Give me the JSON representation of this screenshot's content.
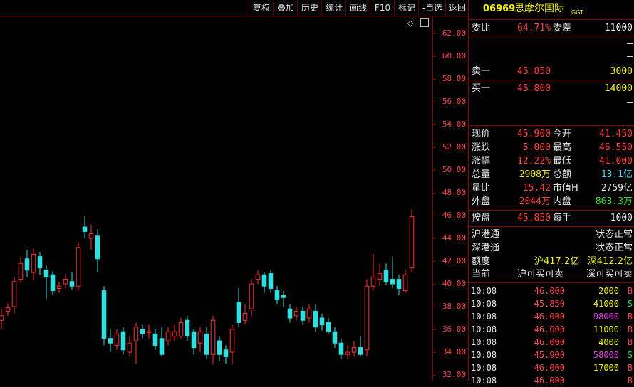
{
  "toolbar": {
    "buttons": [
      "复权",
      "叠加",
      "历史",
      "统计",
      "画线",
      "F10",
      "标记",
      "-自选",
      "返回"
    ]
  },
  "stock": {
    "code": "06969",
    "name": "思摩尔国际",
    "tag": "GGT"
  },
  "order_book": {
    "weibi_label": "委比",
    "weibi_value": "64.71%",
    "weicha_label": "委差",
    "weicha_value": "11000",
    "ask_placeholders": [
      "–",
      "–"
    ],
    "sell1_label": "卖一",
    "sell1_price": "45.850",
    "sell1_qty": "3000",
    "buy1_label": "买一",
    "buy1_price": "45.800",
    "buy1_qty": "14000",
    "bid_placeholders": [
      "–",
      "–"
    ]
  },
  "quote": {
    "rows": [
      {
        "l1": "现价",
        "v1": "45.900",
        "c1": "red",
        "l2": "今开",
        "v2": "41.450",
        "c2": "red"
      },
      {
        "l1": "涨跌",
        "v1": "5.000",
        "c1": "red",
        "l2": "最高",
        "v2": "46.550",
        "c2": "red"
      },
      {
        "l1": "涨幅",
        "v1": "12.22%",
        "c1": "red",
        "l2": "最低",
        "v2": "41.000",
        "c2": "red"
      },
      {
        "l1": "总量",
        "v1": "2908万",
        "c1": "yellow",
        "l2": "总额",
        "v2": "13.1亿",
        "c2": "cyan"
      },
      {
        "l1": "量比",
        "v1": "15.42",
        "c1": "red",
        "l2": "市值H",
        "v2": "2759亿",
        "c2": "white"
      },
      {
        "l1": "外盘",
        "v1": "2044万",
        "c1": "red",
        "l2": "内盘",
        "v2": "863.3万",
        "c2": "green"
      }
    ],
    "anpan_label": "按盘",
    "anpan_value": "45.850",
    "meishou_label": "每手",
    "meishou_value": "1000"
  },
  "connect": {
    "hu_label": "沪港通",
    "hu_status": "状态正常",
    "shen_label": "深港通",
    "shen_status": "状态正常",
    "quota_label": "额度",
    "quota_hu": "沪417.2亿",
    "quota_shen": "深412.2亿",
    "current_label": "当前",
    "current_hu": "沪可买可卖",
    "current_shen": "深可买可卖"
  },
  "trades": [
    {
      "time": "10:08",
      "price": "46.000",
      "qty": "2000",
      "qc": "yellow",
      "dir": "B"
    },
    {
      "time": "10:08",
      "price": "45.850",
      "qty": "41000",
      "qc": "yellow",
      "dir": "S"
    },
    {
      "time": "10:08",
      "price": "46.000",
      "qty": "98000",
      "qc": "magenta",
      "dir": "B"
    },
    {
      "time": "10:08",
      "price": "46.000",
      "qty": "11000",
      "qc": "yellow",
      "dir": "B"
    },
    {
      "time": "10:08",
      "price": "46.000",
      "qty": "4000",
      "qc": "yellow",
      "dir": "B"
    },
    {
      "time": "10:08",
      "price": "45.900",
      "qty": "58000",
      "qc": "magenta",
      "dir": "S"
    },
    {
      "time": "10:08",
      "price": "46.000",
      "qty": "17000",
      "qc": "yellow",
      "dir": "B"
    },
    {
      "time": "10:08",
      "price": "46.000",
      "qty": "",
      "qc": "yellow",
      "dir": "B"
    }
  ],
  "colors": {
    "up": "#ff3030",
    "down": "#30e0e0",
    "border": "#8b0000",
    "axis_text": "#ff4040"
  },
  "chart_data": {
    "type": "candlestick",
    "y_ticks": [
      "62.00",
      "60.00",
      "58.00",
      "56.00",
      "54.00",
      "52.00",
      "50.00",
      "48.00",
      "46.00",
      "44.00",
      "42.00",
      "40.00",
      "38.00",
      "36.00",
      "34.00",
      "32.00"
    ],
    "ylim": [
      31.5,
      63.5
    ],
    "candles": [
      {
        "o": 36.8,
        "c": 37.2,
        "h": 37.8,
        "l": 36.0
      },
      {
        "o": 37.6,
        "c": 37.9,
        "h": 38.3,
        "l": 37.2
      },
      {
        "o": 38.0,
        "c": 40.2,
        "h": 40.6,
        "l": 37.4
      },
      {
        "o": 40.4,
        "c": 41.8,
        "h": 42.4,
        "l": 40.1
      },
      {
        "o": 42.2,
        "c": 41.2,
        "h": 43.0,
        "l": 40.6
      },
      {
        "o": 41.0,
        "c": 42.6,
        "h": 43.1,
        "l": 40.3
      },
      {
        "o": 42.4,
        "c": 41.4,
        "h": 42.8,
        "l": 40.8
      },
      {
        "o": 41.2,
        "c": 40.6,
        "h": 41.6,
        "l": 38.6
      },
      {
        "o": 40.8,
        "c": 39.4,
        "h": 41.1,
        "l": 39.0
      },
      {
        "o": 39.6,
        "c": 39.8,
        "h": 40.2,
        "l": 39.2
      },
      {
        "o": 40.0,
        "c": 40.4,
        "h": 40.9,
        "l": 39.6
      },
      {
        "o": 40.2,
        "c": 39.8,
        "h": 41.0,
        "l": 39.5
      },
      {
        "o": 39.8,
        "c": 43.2,
        "h": 43.6,
        "l": 39.4
      },
      {
        "o": 45.0,
        "c": 44.6,
        "h": 46.0,
        "l": 44.0
      },
      {
        "o": 44.0,
        "c": 44.4,
        "h": 45.2,
        "l": 43.0
      },
      {
        "o": 44.2,
        "c": 42.2,
        "h": 44.8,
        "l": 41.0
      },
      {
        "o": 39.4,
        "c": 35.2,
        "h": 39.8,
        "l": 34.6
      },
      {
        "o": 35.2,
        "c": 34.8,
        "h": 36.0,
        "l": 34.0
      },
      {
        "o": 34.6,
        "c": 35.6,
        "h": 36.0,
        "l": 34.2
      },
      {
        "o": 35.8,
        "c": 34.2,
        "h": 36.2,
        "l": 33.8
      },
      {
        "o": 34.0,
        "c": 34.8,
        "h": 35.4,
        "l": 33.6
      },
      {
        "o": 35.0,
        "c": 36.2,
        "h": 36.6,
        "l": 33.0
      },
      {
        "o": 36.0,
        "c": 35.6,
        "h": 36.4,
        "l": 35.2
      },
      {
        "o": 35.8,
        "c": 35.8,
        "h": 36.4,
        "l": 35.2
      },
      {
        "o": 35.6,
        "c": 34.6,
        "h": 36.0,
        "l": 34.2
      },
      {
        "o": 35.2,
        "c": 33.8,
        "h": 36.2,
        "l": 33.6
      },
      {
        "o": 35.0,
        "c": 35.8,
        "h": 36.2,
        "l": 34.6
      },
      {
        "o": 35.4,
        "c": 35.8,
        "h": 36.4,
        "l": 35.0
      },
      {
        "o": 35.4,
        "c": 36.6,
        "h": 37.0,
        "l": 35.2
      },
      {
        "o": 36.8,
        "c": 35.4,
        "h": 37.2,
        "l": 35.0
      },
      {
        "o": 35.8,
        "c": 34.4,
        "h": 36.0,
        "l": 33.8
      },
      {
        "o": 34.8,
        "c": 35.8,
        "h": 36.2,
        "l": 34.0
      },
      {
        "o": 35.6,
        "c": 33.8,
        "h": 36.2,
        "l": 33.4
      },
      {
        "o": 33.8,
        "c": 36.8,
        "h": 37.2,
        "l": 32.9
      },
      {
        "o": 35.0,
        "c": 33.8,
        "h": 35.4,
        "l": 33.2
      },
      {
        "o": 34.2,
        "c": 33.6,
        "h": 34.6,
        "l": 33.0
      },
      {
        "o": 34.0,
        "c": 36.0,
        "h": 36.4,
        "l": 32.9
      },
      {
        "o": 38.4,
        "c": 36.6,
        "h": 39.6,
        "l": 36.2
      },
      {
        "o": 36.8,
        "c": 37.4,
        "h": 38.2,
        "l": 36.4
      },
      {
        "o": 37.8,
        "c": 40.0,
        "h": 40.4,
        "l": 37.2
      },
      {
        "o": 40.4,
        "c": 40.8,
        "h": 41.2,
        "l": 40.0
      },
      {
        "o": 40.8,
        "c": 39.8,
        "h": 41.0,
        "l": 39.2
      },
      {
        "o": 40.9,
        "c": 39.6,
        "h": 41.2,
        "l": 39.2
      },
      {
        "o": 39.4,
        "c": 38.6,
        "h": 39.8,
        "l": 38.2
      },
      {
        "o": 39.0,
        "c": 38.8,
        "h": 39.4,
        "l": 38.0
      },
      {
        "o": 37.8,
        "c": 37.0,
        "h": 38.2,
        "l": 36.6
      },
      {
        "o": 37.2,
        "c": 37.6,
        "h": 38.0,
        "l": 36.8
      },
      {
        "o": 37.6,
        "c": 36.8,
        "h": 38.0,
        "l": 36.4
      },
      {
        "o": 37.0,
        "c": 37.8,
        "h": 38.2,
        "l": 36.6
      },
      {
        "o": 37.6,
        "c": 36.2,
        "h": 38.2,
        "l": 35.8
      },
      {
        "o": 37.0,
        "c": 36.4,
        "h": 37.4,
        "l": 35.9
      },
      {
        "o": 36.6,
        "c": 35.8,
        "h": 37.0,
        "l": 35.6
      },
      {
        "o": 35.8,
        "c": 34.8,
        "h": 36.2,
        "l": 34.4
      },
      {
        "o": 34.8,
        "c": 33.8,
        "h": 35.2,
        "l": 33.4
      },
      {
        "o": 33.8,
        "c": 34.0,
        "h": 34.6,
        "l": 33.4
      },
      {
        "o": 34.0,
        "c": 34.4,
        "h": 35.0,
        "l": 33.6
      },
      {
        "o": 34.4,
        "c": 33.8,
        "h": 35.4,
        "l": 33.6
      },
      {
        "o": 34.2,
        "c": 39.8,
        "h": 40.4,
        "l": 33.6
      },
      {
        "o": 39.8,
        "c": 40.6,
        "h": 42.6,
        "l": 39.4
      },
      {
        "o": 40.4,
        "c": 40.9,
        "h": 41.8,
        "l": 39.8
      },
      {
        "o": 41.2,
        "c": 40.2,
        "h": 41.8,
        "l": 39.9
      },
      {
        "o": 40.4,
        "c": 40.0,
        "h": 42.4,
        "l": 39.6
      },
      {
        "o": 40.4,
        "c": 39.6,
        "h": 40.8,
        "l": 39.0
      },
      {
        "o": 39.4,
        "c": 40.8,
        "h": 41.2,
        "l": 39.2
      },
      {
        "o": 41.4,
        "c": 45.9,
        "h": 46.55,
        "l": 41.0
      }
    ]
  }
}
